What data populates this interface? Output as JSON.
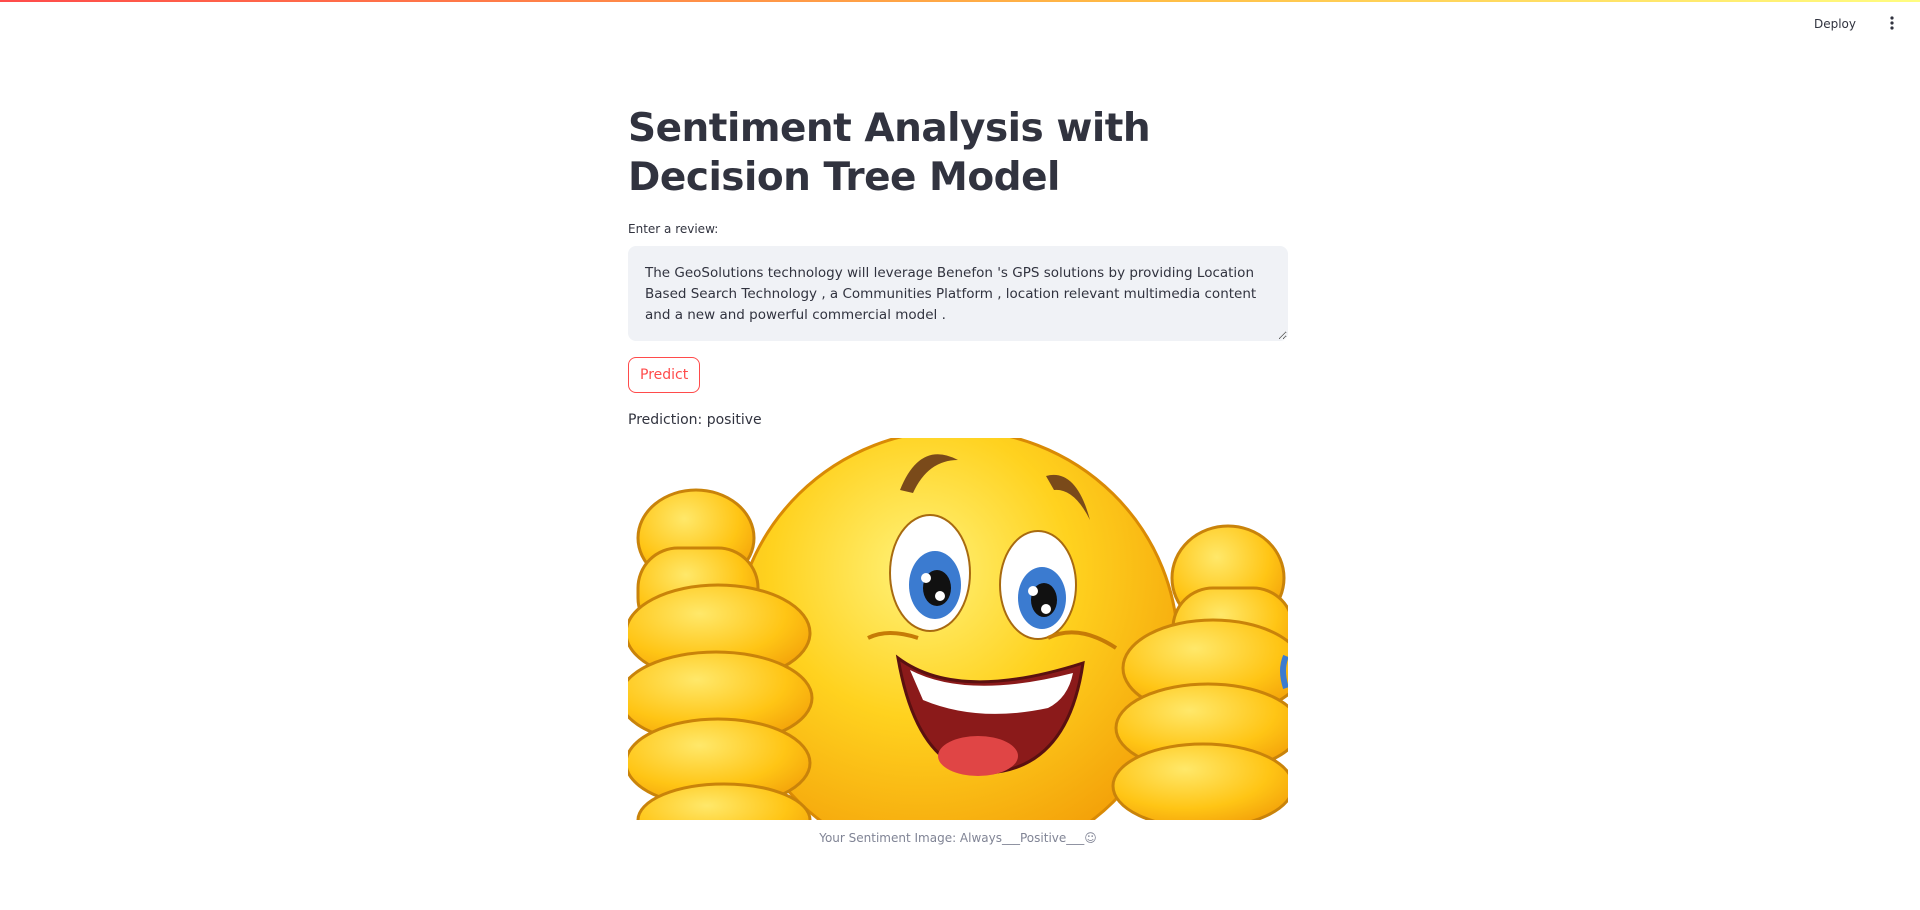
{
  "header": {
    "deploy_label": "Deploy",
    "menu_icon": "kebab-menu-icon"
  },
  "main": {
    "title": "Sentiment Analysis with Decision Tree Model",
    "review_label": "Enter a review:",
    "review_value": "The GeoSolutions technology will leverage Benefon 's GPS solutions by providing Location Based Search Technology , a Communities Platform , location relevant multimedia content and a new and powerful commercial model .",
    "predict_label": "Predict",
    "prediction_text": "Prediction: positive",
    "image_icon": "thumbs-up-smiley-icon",
    "caption": "Your Sentiment Image: Always___Positive___☺"
  },
  "colors": {
    "accent": "#ff4b4b",
    "text": "#31333F",
    "input_bg": "#f0f2f6",
    "caption": "#808495"
  }
}
